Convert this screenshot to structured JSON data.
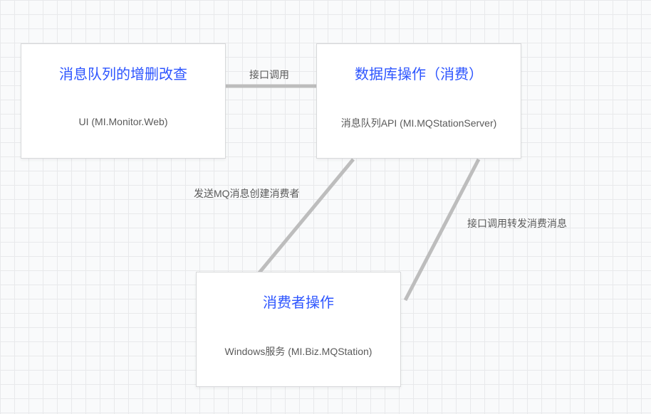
{
  "nodes": {
    "ui": {
      "title": "消息队列的增删改查",
      "subtitle": "UI (MI.Monitor.Web)"
    },
    "db": {
      "title": "数据库操作（消费）",
      "subtitle": "消息队列API (MI.MQStationServer)"
    },
    "consumer": {
      "title": "消费者操作",
      "subtitle": "Windows服务 (MI.Biz.MQStation)"
    }
  },
  "edges": {
    "ui_db": {
      "label": "接口调用"
    },
    "db_consumer_left": {
      "label": "发送MQ消息创建消费者"
    },
    "db_consumer_right": {
      "label": "接口调用转发消费消息"
    }
  }
}
